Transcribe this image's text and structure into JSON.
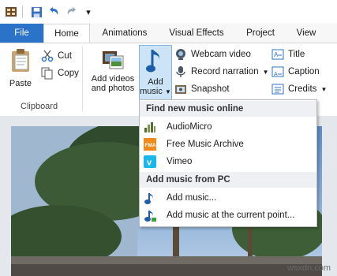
{
  "qat": {
    "more_glyph": "▾"
  },
  "tabs": [
    {
      "label": "File"
    },
    {
      "label": "Home"
    },
    {
      "label": "Animations"
    },
    {
      "label": "Visual Effects"
    },
    {
      "label": "Project"
    },
    {
      "label": "View"
    }
  ],
  "ribbon": {
    "paste": "Paste",
    "cut": "Cut",
    "copy": "Copy",
    "clipboard_group": "Clipboard",
    "add_videos": [
      "Add videos",
      "and photos"
    ],
    "add_music": [
      "Add",
      "music"
    ],
    "webcam": "Webcam video",
    "record": "Record narration",
    "snapshot": "Snapshot",
    "title": "Title",
    "caption": "Caption",
    "credits": "Credits"
  },
  "menu": {
    "header_online": "Find new music online",
    "online_items": [
      "AudioMicro",
      "Free Music Archive",
      "Vimeo"
    ],
    "header_pc": "Add music from PC",
    "pc_items": [
      "Add music...",
      "Add music at the current point..."
    ]
  },
  "watermark": "wsxdn.com",
  "colors": {
    "accent": "#2b73c9",
    "selected": "#cde4f7"
  }
}
